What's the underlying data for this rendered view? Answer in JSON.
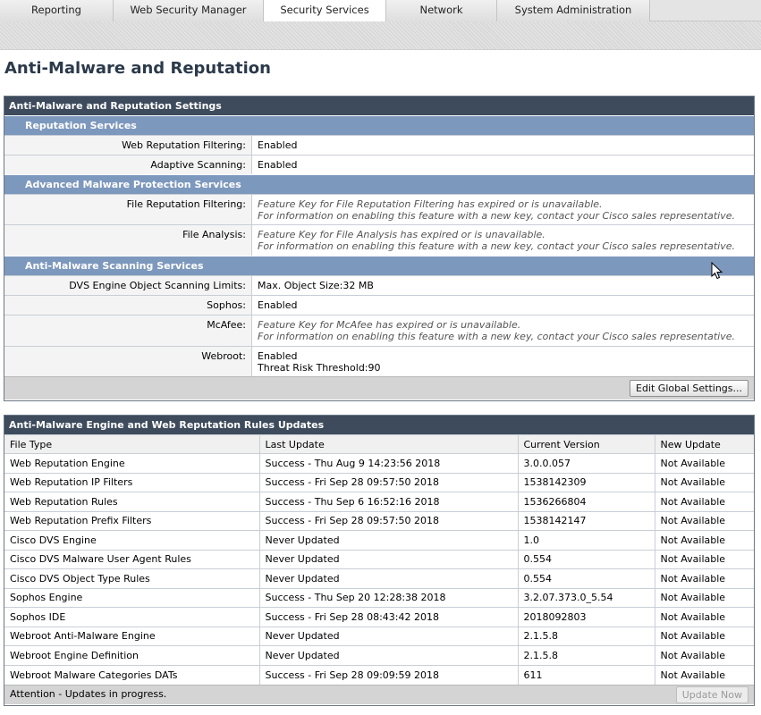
{
  "nav": {
    "tabs": [
      {
        "label": "Reporting",
        "active": false
      },
      {
        "label": "Web Security Manager",
        "active": false
      },
      {
        "label": "Security Services",
        "active": true
      },
      {
        "label": "Network",
        "active": false
      },
      {
        "label": "System Administration",
        "active": false
      }
    ]
  },
  "page_title": "Anti-Malware and Reputation",
  "settings": {
    "title": "Anti-Malware and Reputation Settings",
    "reputation": {
      "heading": "Reputation Services",
      "web_reputation_filtering": {
        "label": "Web Reputation Filtering:",
        "value": "Enabled"
      },
      "adaptive_scanning": {
        "label": "Adaptive Scanning:",
        "value": "Enabled"
      }
    },
    "amp": {
      "heading": "Advanced Malware Protection Services",
      "file_reputation": {
        "label": "File Reputation Filtering:",
        "line1": "Feature Key for File Reputation Filtering has expired or is unavailable.",
        "line2": "For information on enabling this feature with a new key, contact your Cisco sales representative."
      },
      "file_analysis": {
        "label": "File Analysis:",
        "line1": "Feature Key for File Analysis has expired or is unavailable.",
        "line2": "For information on enabling this feature with a new key, contact your Cisco sales representative."
      }
    },
    "scanning": {
      "heading": "Anti-Malware Scanning Services",
      "dvs": {
        "label": "DVS Engine Object Scanning Limits:",
        "value": "Max. Object Size:32 MB"
      },
      "sophos": {
        "label": "Sophos:",
        "value": "Enabled"
      },
      "mcafee": {
        "label": "McAfee:",
        "line1": "Feature Key for McAfee has expired or is unavailable.",
        "line2": "For information on enabling this feature with a new key, contact your Cisco sales representative."
      },
      "webroot": {
        "label": "Webroot:",
        "line1": "Enabled",
        "line2": "Threat Risk Threshold:90"
      }
    },
    "edit_button": "Edit Global Settings..."
  },
  "updates": {
    "title": "Anti-Malware Engine and Web Reputation Rules Updates",
    "headers": {
      "file_type": "File Type",
      "last_update": "Last Update",
      "current_version": "Current Version",
      "new_update": "New Update"
    },
    "rows": [
      {
        "file_type": "Web Reputation Engine",
        "last_update": "Success - Thu Aug 9 14:23:56 2018",
        "current_version": "3.0.0.057",
        "new_update": "Not Available"
      },
      {
        "file_type": "Web Reputation IP Filters",
        "last_update": "Success - Fri Sep 28 09:57:50 2018",
        "current_version": "1538142309",
        "new_update": "Not Available"
      },
      {
        "file_type": "Web Reputation Rules",
        "last_update": "Success - Thu Sep 6 16:52:16 2018",
        "current_version": "1536266804",
        "new_update": "Not Available"
      },
      {
        "file_type": "Web Reputation Prefix Filters",
        "last_update": "Success - Fri Sep 28 09:57:50 2018",
        "current_version": "1538142147",
        "new_update": "Not Available"
      },
      {
        "file_type": "Cisco DVS Engine",
        "last_update": "Never Updated",
        "current_version": "1.0",
        "new_update": "Not Available"
      },
      {
        "file_type": "Cisco DVS Malware User Agent Rules",
        "last_update": "Never Updated",
        "current_version": "0.554",
        "new_update": "Not Available"
      },
      {
        "file_type": "Cisco DVS Object Type Rules",
        "last_update": "Never Updated",
        "current_version": "0.554",
        "new_update": "Not Available"
      },
      {
        "file_type": "Sophos Engine",
        "last_update": "Success - Thu Sep 20 12:28:38 2018",
        "current_version": "3.2.07.373.0_5.54",
        "new_update": "Not Available"
      },
      {
        "file_type": "Sophos IDE",
        "last_update": "Success - Fri Sep 28 08:43:42 2018",
        "current_version": "2018092803",
        "new_update": "Not Available"
      },
      {
        "file_type": "Webroot Anti-Malware Engine",
        "last_update": "Never Updated",
        "current_version": "2.1.5.8",
        "new_update": "Not Available"
      },
      {
        "file_type": "Webroot Engine Definition",
        "last_update": "Never Updated",
        "current_version": "2.1.5.8",
        "new_update": "Not Available"
      },
      {
        "file_type": "Webroot Malware Categories DATs",
        "last_update": "Success - Fri Sep 28 09:09:59 2018",
        "current_version": "611",
        "new_update": "Not Available"
      }
    ],
    "attention": "Attention - Updates in progress.",
    "update_now_button": "Update Now"
  }
}
